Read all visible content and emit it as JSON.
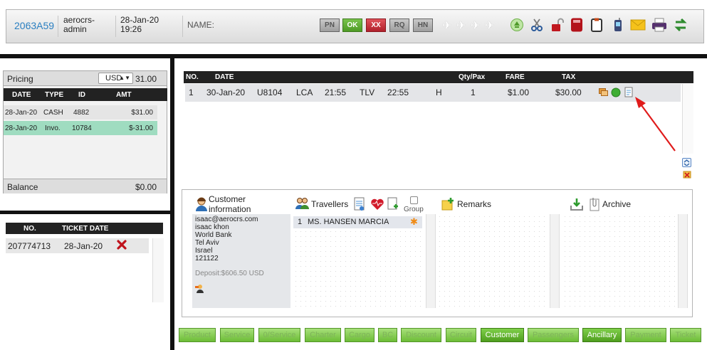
{
  "header": {
    "pnr": "2063A59",
    "agent_line1": "aerocrs-",
    "agent_line2": "admin",
    "date": "28-Jan-20",
    "time": "19:26",
    "name_label": "NAME:",
    "mode_buttons": [
      "PN",
      "OK",
      "XX",
      "RQ",
      "HN"
    ],
    "toolbar_icons": [
      "plane-icon",
      "plane-icon",
      "plane-icon",
      "plane-icon",
      "recycle-icon",
      "scissors-icon",
      "unlock-icon",
      "calculator-icon",
      "clipboard-icon",
      "mobile-icon",
      "envelope-icon",
      "printer-icon",
      "swap-icon"
    ]
  },
  "pricing": {
    "title": "Pricing",
    "currency": "USD",
    "total": "31.00",
    "columns": [
      "DATE",
      "TYPE",
      "ID",
      "AMT"
    ],
    "rows": [
      {
        "date": "28-Jan-20",
        "type": "CASH",
        "id": "4882",
        "amt": "$31.00"
      },
      {
        "date": "28-Jan-20",
        "type": "Invo.",
        "id": "10784",
        "amt": "$-31.00"
      }
    ],
    "balance_label": "Balance",
    "balance_value": "$0.00"
  },
  "tickets": {
    "columns": [
      "NO.",
      "TICKET DATE"
    ],
    "rows": [
      {
        "no": "207774713",
        "date": "28-Jan-20"
      }
    ]
  },
  "segments": {
    "columns": {
      "no": "NO.",
      "date": "DATE",
      "qty": "Qty/Pax",
      "fare": "FARE",
      "tax": "TAX"
    },
    "rows": [
      {
        "no": "1",
        "date": "30-Jan-20",
        "flight": "U8104",
        "from": "LCA",
        "dep": "21:55",
        "to": "TLV",
        "arr": "22:55",
        "class": "H",
        "qty": "1",
        "fare": "$1.00",
        "tax": "$30.00"
      }
    ]
  },
  "customer": {
    "title_line1": "Customer",
    "title_line2": "information",
    "email": "isaac@aerocrs.com",
    "name": "isaac khon",
    "company": "World Bank",
    "city": "Tel Aviv",
    "country": "Israel",
    "phone": "121122",
    "deposit": "Deposit:$606.50 USD"
  },
  "travellers": {
    "title": "Travellers",
    "group_label": "Group",
    "list": [
      {
        "no": "1",
        "name": "MS. HANSEN MARCIA"
      }
    ]
  },
  "remarks": {
    "title": "Remarks"
  },
  "archive": {
    "title": "Archive"
  },
  "tabs": [
    {
      "label": "Product",
      "active": false
    },
    {
      "label": "Service",
      "active": false
    },
    {
      "label": "0/Service",
      "active": false
    },
    {
      "label": "Charter",
      "active": false
    },
    {
      "label": "Cargo",
      "active": false
    },
    {
      "label": "BC",
      "active": false
    },
    {
      "label": "Discount",
      "active": false
    },
    {
      "label": "Circuit",
      "active": false
    },
    {
      "label": "Customer",
      "active": true
    },
    {
      "label": "Passengers",
      "active": false
    },
    {
      "label": "Ancillary",
      "active": true
    },
    {
      "label": "Payment",
      "active": false
    },
    {
      "label": "Ticket",
      "active": false
    }
  ],
  "colors": {
    "accent_blue": "#2a7fc1",
    "tab_green": "#6cbc36",
    "highlight_row": "#9fdcc0",
    "annotation_red": "#e01b1b"
  }
}
